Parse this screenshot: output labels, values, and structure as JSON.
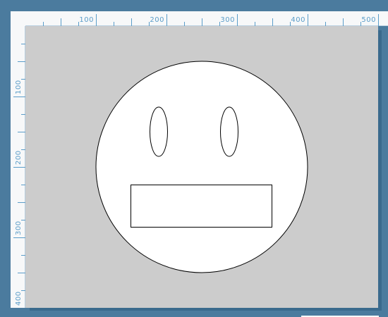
{
  "ruler": {
    "top_labels": [
      "100",
      "200",
      "300",
      "400",
      "500"
    ],
    "left_labels": [
      "100",
      "200",
      "300",
      "400"
    ],
    "color": "#5b9dc9"
  },
  "canvas": {
    "background": "#cccccc",
    "shapes": [
      {
        "name": "face-circle",
        "kind": "circle",
        "fill": "#ffffff",
        "stroke": "#000000"
      },
      {
        "name": "left-eye",
        "kind": "ellipse",
        "fill": "#ffffff",
        "stroke": "#000000"
      },
      {
        "name": "right-eye",
        "kind": "ellipse",
        "fill": "#ffffff",
        "stroke": "#000000"
      },
      {
        "name": "mouth-rect",
        "kind": "rect",
        "fill": "#ffffff",
        "stroke": "#000000"
      }
    ]
  },
  "colors": {
    "window_background": "#4b7b9e",
    "ruler_background": "#f7f8f9"
  }
}
